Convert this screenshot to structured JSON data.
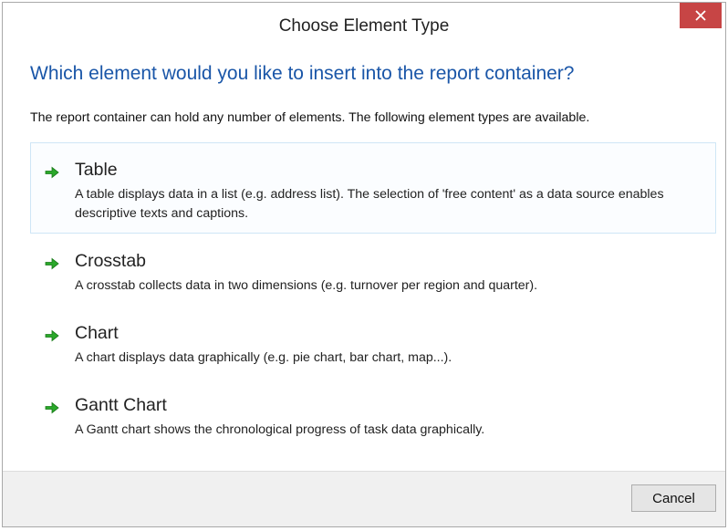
{
  "window": {
    "title": "Choose Element Type",
    "close_icon": "close-icon",
    "close_color": "#c74545"
  },
  "main": {
    "heading": "Which element would you like to insert into the report container?",
    "heading_color": "#1a56a8",
    "description": "The report container can hold any number of elements. The following element types are available."
  },
  "options": [
    {
      "title": "Table",
      "description": "A table displays data in a list (e.g. address list). The selection of 'free content' as a data source enables descriptive texts and captions.",
      "icon": "green-arrow-icon",
      "selected": true
    },
    {
      "title": "Crosstab",
      "description": "A crosstab collects data in two dimensions (e.g. turnover per region and quarter).",
      "icon": "green-arrow-icon",
      "selected": false
    },
    {
      "title": "Chart",
      "description": "A chart displays data graphically (e.g. pie chart, bar chart, map...).",
      "icon": "green-arrow-icon",
      "selected": false
    },
    {
      "title": "Gantt Chart",
      "description": "A Gantt chart shows the chronological progress of task data graphically.",
      "icon": "green-arrow-icon",
      "selected": false
    }
  ],
  "footer": {
    "cancel_label": "Cancel"
  }
}
